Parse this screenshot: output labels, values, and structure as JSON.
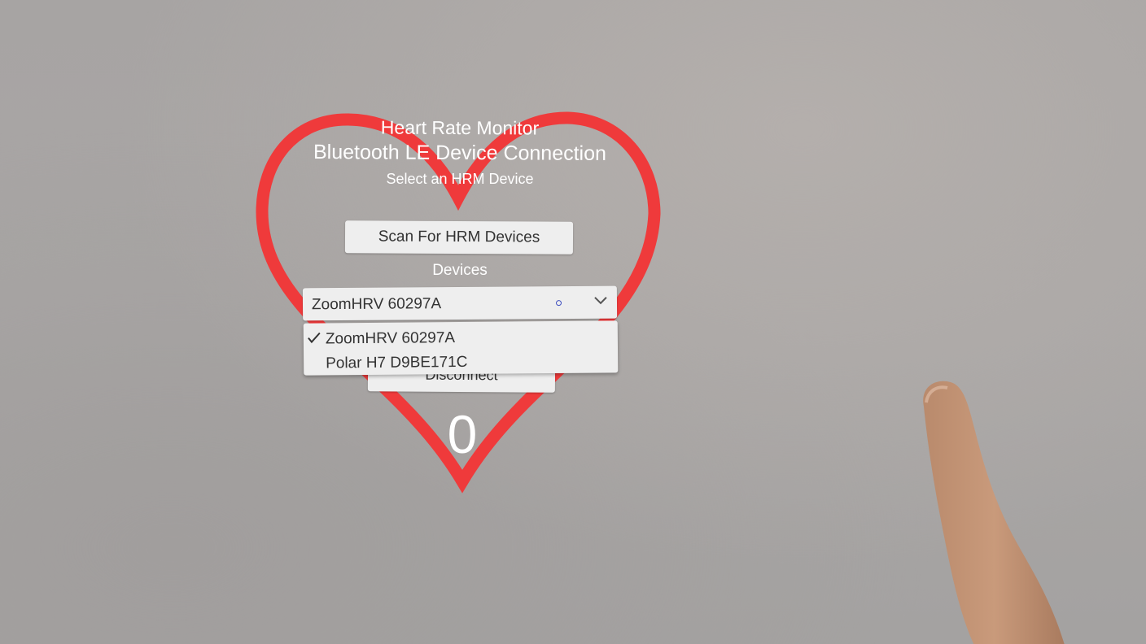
{
  "header": {
    "title_line_1": "Heart Rate Monitor",
    "title_line_2": "Bluetooth LE Device Connection",
    "subtitle": "Select an HRM Device"
  },
  "scan_button": {
    "label": "Scan For HRM Devices"
  },
  "devices": {
    "label": "Devices",
    "selected": "ZoomHRV 60297A",
    "options": [
      {
        "label": "ZoomHRV 60297A",
        "checked": true
      },
      {
        "label": "Polar H7 D9BE171C",
        "checked": false
      }
    ]
  },
  "disconnect_button": {
    "label": "Disconnect"
  },
  "heart_rate": {
    "value": "0"
  },
  "colors": {
    "heart": "#ef3a3b",
    "text_white": "#ffffff",
    "button_bg": "#eeeeee"
  }
}
